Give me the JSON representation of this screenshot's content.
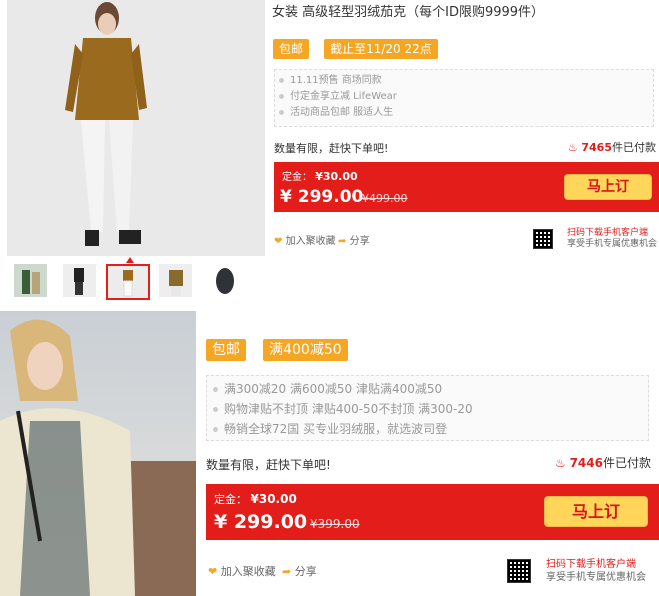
{
  "top": {
    "title": "女装 高级轻型羽绒茄克（每个ID限购9999件）",
    "tags": [
      "包邮",
      "截止至11/20 22点"
    ],
    "notes": [
      "11.11预售 商场同款",
      "付定金享立减 LifeWear",
      "活动商品包邮 服适人生"
    ],
    "limit_text": "数量有限，赶快下单吧!",
    "paid_count": "7465",
    "paid_suffix": "件已付款",
    "deposit_label": "定金：",
    "deposit_value": "¥30.00",
    "price": "¥ 299.00",
    "orig_price": "¥499.00",
    "buy_label": "马上订",
    "fav_label": "加入聚收藏",
    "share_label": "分享",
    "qr_text1": "扫码下载手机客户端",
    "qr_text2": "享受手机专属优惠机会"
  },
  "bottom": {
    "tags": [
      "包邮",
      "满400减50"
    ],
    "notes": [
      "满300减20 满600减50 津贴满400减50",
      "购物津贴不封顶 津贴400-50不封顶 满300-20",
      "畅销全球72国 买专业羽绒服，就选波司登"
    ],
    "limit_text": "数量有限，赶快下单吧!",
    "paid_count": "7446",
    "paid_suffix": "件已付款",
    "deposit_label": "定金：",
    "deposit_value": "¥30.00",
    "price": "¥ 299.00",
    "orig_price": "¥399.00",
    "buy_label": "马上订",
    "fav_label": "加入聚收藏",
    "share_label": "分享",
    "qr_text1": "扫码下载手机客户端",
    "qr_text2": "享受手机专属优惠机会"
  },
  "colors": {
    "accent_red": "#e31d1a",
    "tag_orange": "#f5a623",
    "button_yellow": "#ffd65a"
  },
  "icons": [
    "heart-icon",
    "share-arrow-icon",
    "fire-icon",
    "qr-code-icon",
    "caret-up-icon"
  ]
}
